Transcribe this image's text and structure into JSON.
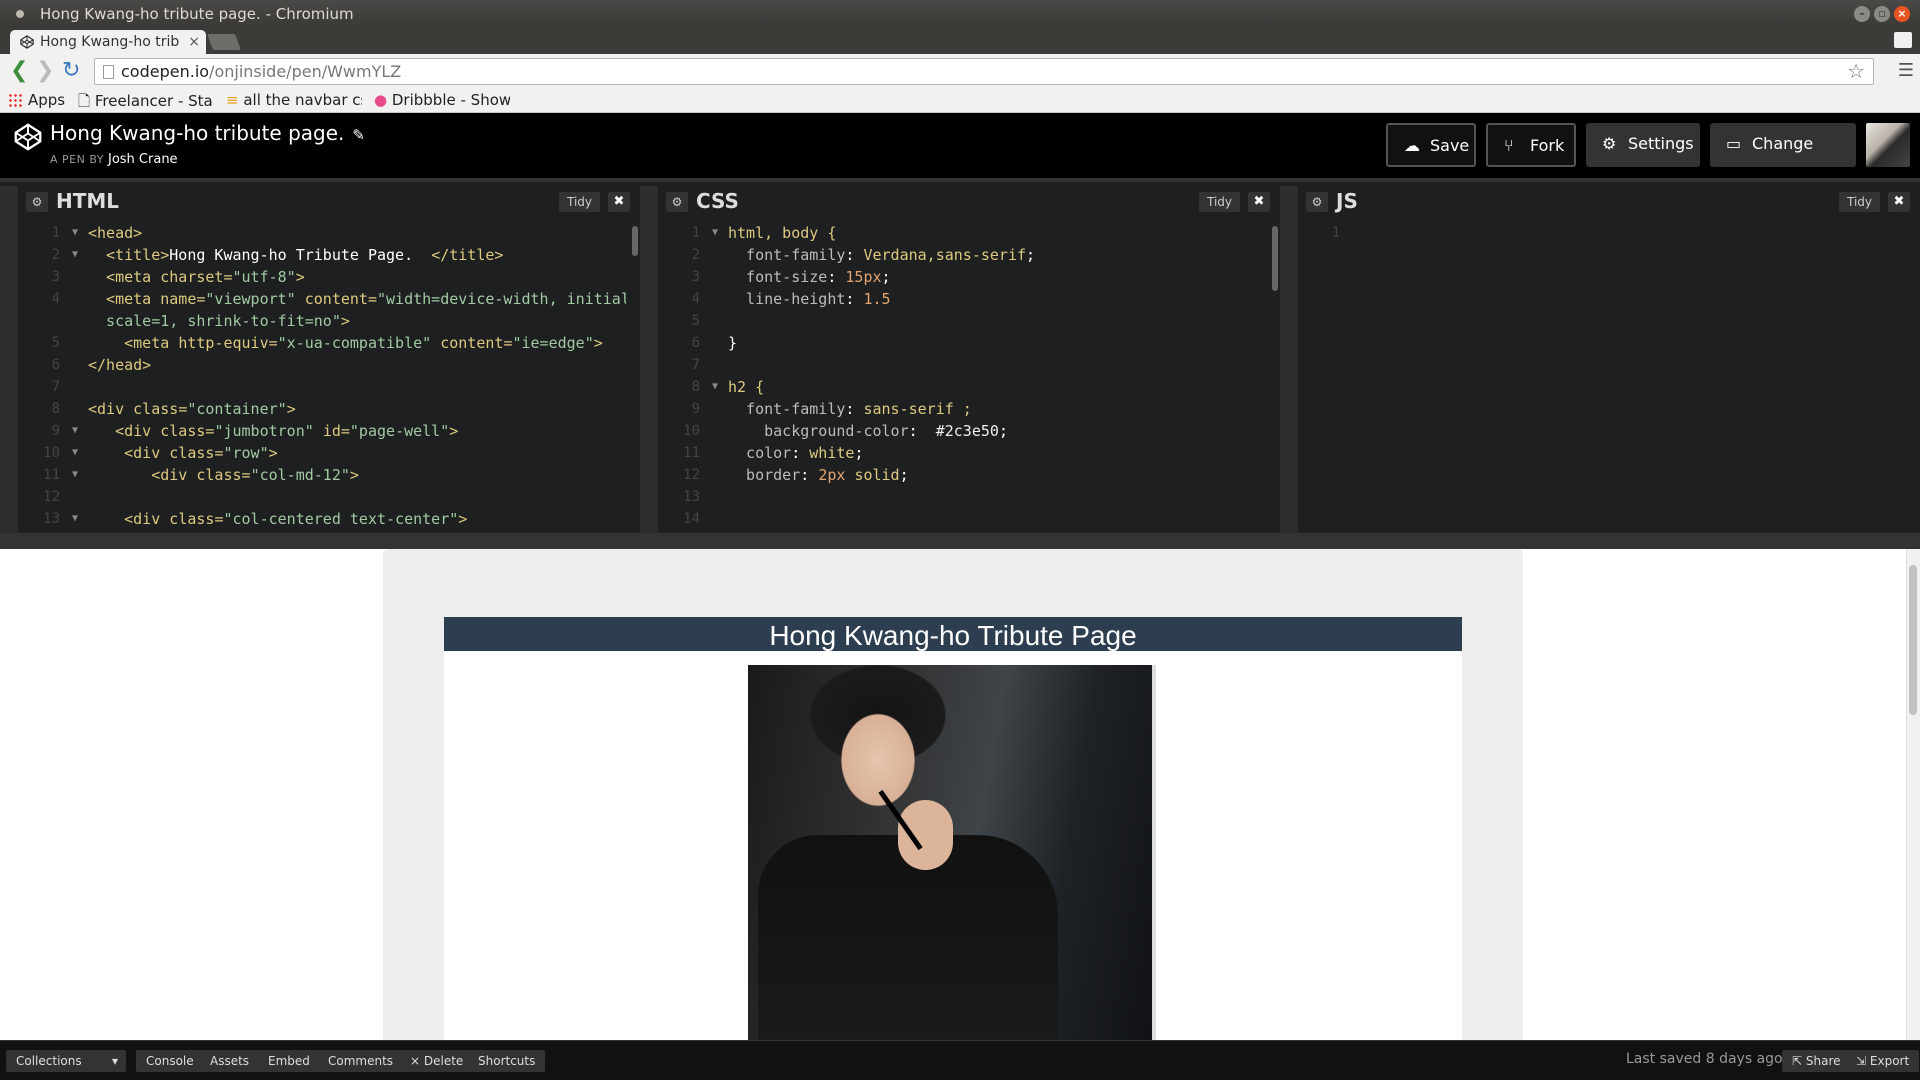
{
  "window": {
    "title": "Hong Kwang-ho tribute page. - Chromium"
  },
  "tab": {
    "label": "Hong Kwang-ho trib",
    "close": "×"
  },
  "address": {
    "host": "codepen.io",
    "path": "/onjinside/pen/WwmYLZ"
  },
  "bookmarks": [
    {
      "label": "Apps"
    },
    {
      "label": "Freelancer - Start",
      "fade": ""
    },
    {
      "label": "all the navbar css",
      "fade": ""
    },
    {
      "label": "Dribbble - Show",
      "fade": ""
    }
  ],
  "pen": {
    "title": "Hong Kwang-ho tribute page.",
    "by_prefix": "A PEN BY",
    "author": "Josh Crane"
  },
  "toolbar": {
    "save": "Save",
    "fork": "Fork",
    "settings": "Settings",
    "change_view": "Change View"
  },
  "editors": {
    "html": {
      "name": "HTML",
      "tidy": "Tidy"
    },
    "css": {
      "name": "CSS",
      "tidy": "Tidy"
    },
    "js": {
      "name": "JS",
      "tidy": "Tidy"
    }
  },
  "html_lines": [
    {
      "n": "1",
      "fold": true,
      "segs": [
        [
          "tag",
          "<head>"
        ]
      ]
    },
    {
      "n": "2",
      "fold": true,
      "segs": [
        [
          "tag",
          "  <title>"
        ],
        [
          "white",
          "Hong Kwang-ho Tribute Page.  "
        ],
        [
          "tag",
          "</title>"
        ]
      ]
    },
    {
      "n": "3",
      "fold": false,
      "segs": [
        [
          "tag",
          "  <meta "
        ],
        [
          "attr",
          "charset"
        ],
        [
          "tag",
          "="
        ],
        [
          "str",
          "\"utf-8\""
        ],
        [
          "tag",
          ">"
        ]
      ]
    },
    {
      "n": "4",
      "fold": false,
      "segs": [
        [
          "tag",
          "  <meta "
        ],
        [
          "attr",
          "name"
        ],
        [
          "tag",
          "="
        ],
        [
          "str",
          "\"viewport\" "
        ],
        [
          "attr",
          "content"
        ],
        [
          "tag",
          "="
        ],
        [
          "str",
          "\"width=device-width, initial-"
        ]
      ]
    },
    {
      "n": "",
      "fold": false,
      "segs": [
        [
          "str",
          "  scale=1, shrink-to-fit=no\""
        ],
        [
          "tag",
          ">"
        ]
      ]
    },
    {
      "n": "5",
      "fold": false,
      "segs": [
        [
          "tag",
          "    <meta "
        ],
        [
          "attr",
          "http-equiv"
        ],
        [
          "tag",
          "="
        ],
        [
          "str",
          "\"x-ua-compatible\" "
        ],
        [
          "attr",
          "content"
        ],
        [
          "tag",
          "="
        ],
        [
          "str",
          "\"ie=edge\""
        ],
        [
          "tag",
          ">"
        ]
      ]
    },
    {
      "n": "6",
      "fold": false,
      "segs": [
        [
          "tag",
          "</head>"
        ]
      ]
    },
    {
      "n": "7",
      "fold": false,
      "segs": []
    },
    {
      "n": "8",
      "fold": false,
      "segs": [
        [
          "tag",
          "<div "
        ],
        [
          "attr",
          "class"
        ],
        [
          "tag",
          "="
        ],
        [
          "str",
          "\"container\""
        ],
        [
          "tag",
          ">"
        ]
      ]
    },
    {
      "n": "9",
      "fold": true,
      "segs": [
        [
          "tag",
          "   <div "
        ],
        [
          "attr",
          "class"
        ],
        [
          "tag",
          "="
        ],
        [
          "str",
          "\"jumbotron\" "
        ],
        [
          "attr",
          "id"
        ],
        [
          "tag",
          "="
        ],
        [
          "str",
          "\"page-well\""
        ],
        [
          "tag",
          ">"
        ]
      ]
    },
    {
      "n": "10",
      "fold": true,
      "segs": [
        [
          "tag",
          "    <div "
        ],
        [
          "attr",
          "class"
        ],
        [
          "tag",
          "="
        ],
        [
          "str",
          "\"row\""
        ],
        [
          "tag",
          ">"
        ]
      ]
    },
    {
      "n": "11",
      "fold": true,
      "segs": [
        [
          "tag",
          "       <div "
        ],
        [
          "attr",
          "class"
        ],
        [
          "tag",
          "="
        ],
        [
          "str",
          "\"col-md-12\""
        ],
        [
          "tag",
          ">"
        ]
      ]
    },
    {
      "n": "12",
      "fold": false,
      "segs": []
    },
    {
      "n": "13",
      "fold": true,
      "segs": [
        [
          "tag",
          "    <div "
        ],
        [
          "attr",
          "class"
        ],
        [
          "tag",
          "="
        ],
        [
          "str",
          "\"col-centered text-center\""
        ],
        [
          "tag",
          ">"
        ]
      ]
    }
  ],
  "css_lines": [
    {
      "n": "1",
      "fold": true,
      "segs": [
        [
          "sel",
          "html, body {"
        ]
      ]
    },
    {
      "n": "2",
      "fold": false,
      "segs": [
        [
          "prop",
          "  font-family"
        ],
        [
          "white",
          ": "
        ],
        [
          "sel",
          "Verdana,sans-serif"
        ],
        [
          "white",
          ";"
        ]
      ]
    },
    {
      "n": "3",
      "fold": false,
      "segs": [
        [
          "prop",
          "  font-size"
        ],
        [
          "white",
          ": "
        ],
        [
          "num",
          "15px"
        ],
        [
          "white",
          ";"
        ]
      ]
    },
    {
      "n": "4",
      "fold": false,
      "segs": [
        [
          "prop",
          "  line-height"
        ],
        [
          "white",
          ": "
        ],
        [
          "num",
          "1.5"
        ]
      ]
    },
    {
      "n": "5",
      "fold": false,
      "segs": []
    },
    {
      "n": "6",
      "fold": false,
      "segs": [
        [
          "white",
          "}"
        ]
      ]
    },
    {
      "n": "7",
      "fold": false,
      "segs": []
    },
    {
      "n": "8",
      "fold": true,
      "segs": [
        [
          "sel",
          "h2 {"
        ]
      ]
    },
    {
      "n": "9",
      "fold": false,
      "segs": [
        [
          "prop",
          "  font-family"
        ],
        [
          "white",
          ": "
        ],
        [
          "sel",
          "sans-serif ;"
        ]
      ]
    },
    {
      "n": "10",
      "fold": false,
      "segs": [
        [
          "prop",
          "    background-color"
        ],
        [
          "white",
          ":  "
        ],
        [
          "hex",
          "#2c3e50"
        ],
        [
          "white",
          ";"
        ]
      ]
    },
    {
      "n": "11",
      "fold": false,
      "segs": [
        [
          "prop",
          "  color"
        ],
        [
          "white",
          ": "
        ],
        [
          "sel",
          "white"
        ],
        [
          "white",
          ";"
        ]
      ]
    },
    {
      "n": "12",
      "fold": false,
      "segs": [
        [
          "prop",
          "  border"
        ],
        [
          "white",
          ": "
        ],
        [
          "num",
          "2px "
        ],
        [
          "sel",
          "solid"
        ],
        [
          "white",
          ";"
        ]
      ]
    },
    {
      "n": "13",
      "fold": false,
      "segs": []
    },
    {
      "n": "14",
      "fold": false,
      "segs": []
    }
  ],
  "js_lines": [
    {
      "n": "1",
      "fold": false,
      "segs": []
    }
  ],
  "preview": {
    "heading": "Hong Kwang-ho Tribute Page",
    "heading_bg": "#2c3e50"
  },
  "footer": {
    "collections": "Collections",
    "console": "Console",
    "assets": "Assets",
    "embed": "Embed",
    "comments": "Comments",
    "delete": "× Delete",
    "shortcuts": "Shortcuts",
    "last_saved": "Last saved 8 days ago",
    "share": "Share",
    "export": "Export"
  }
}
